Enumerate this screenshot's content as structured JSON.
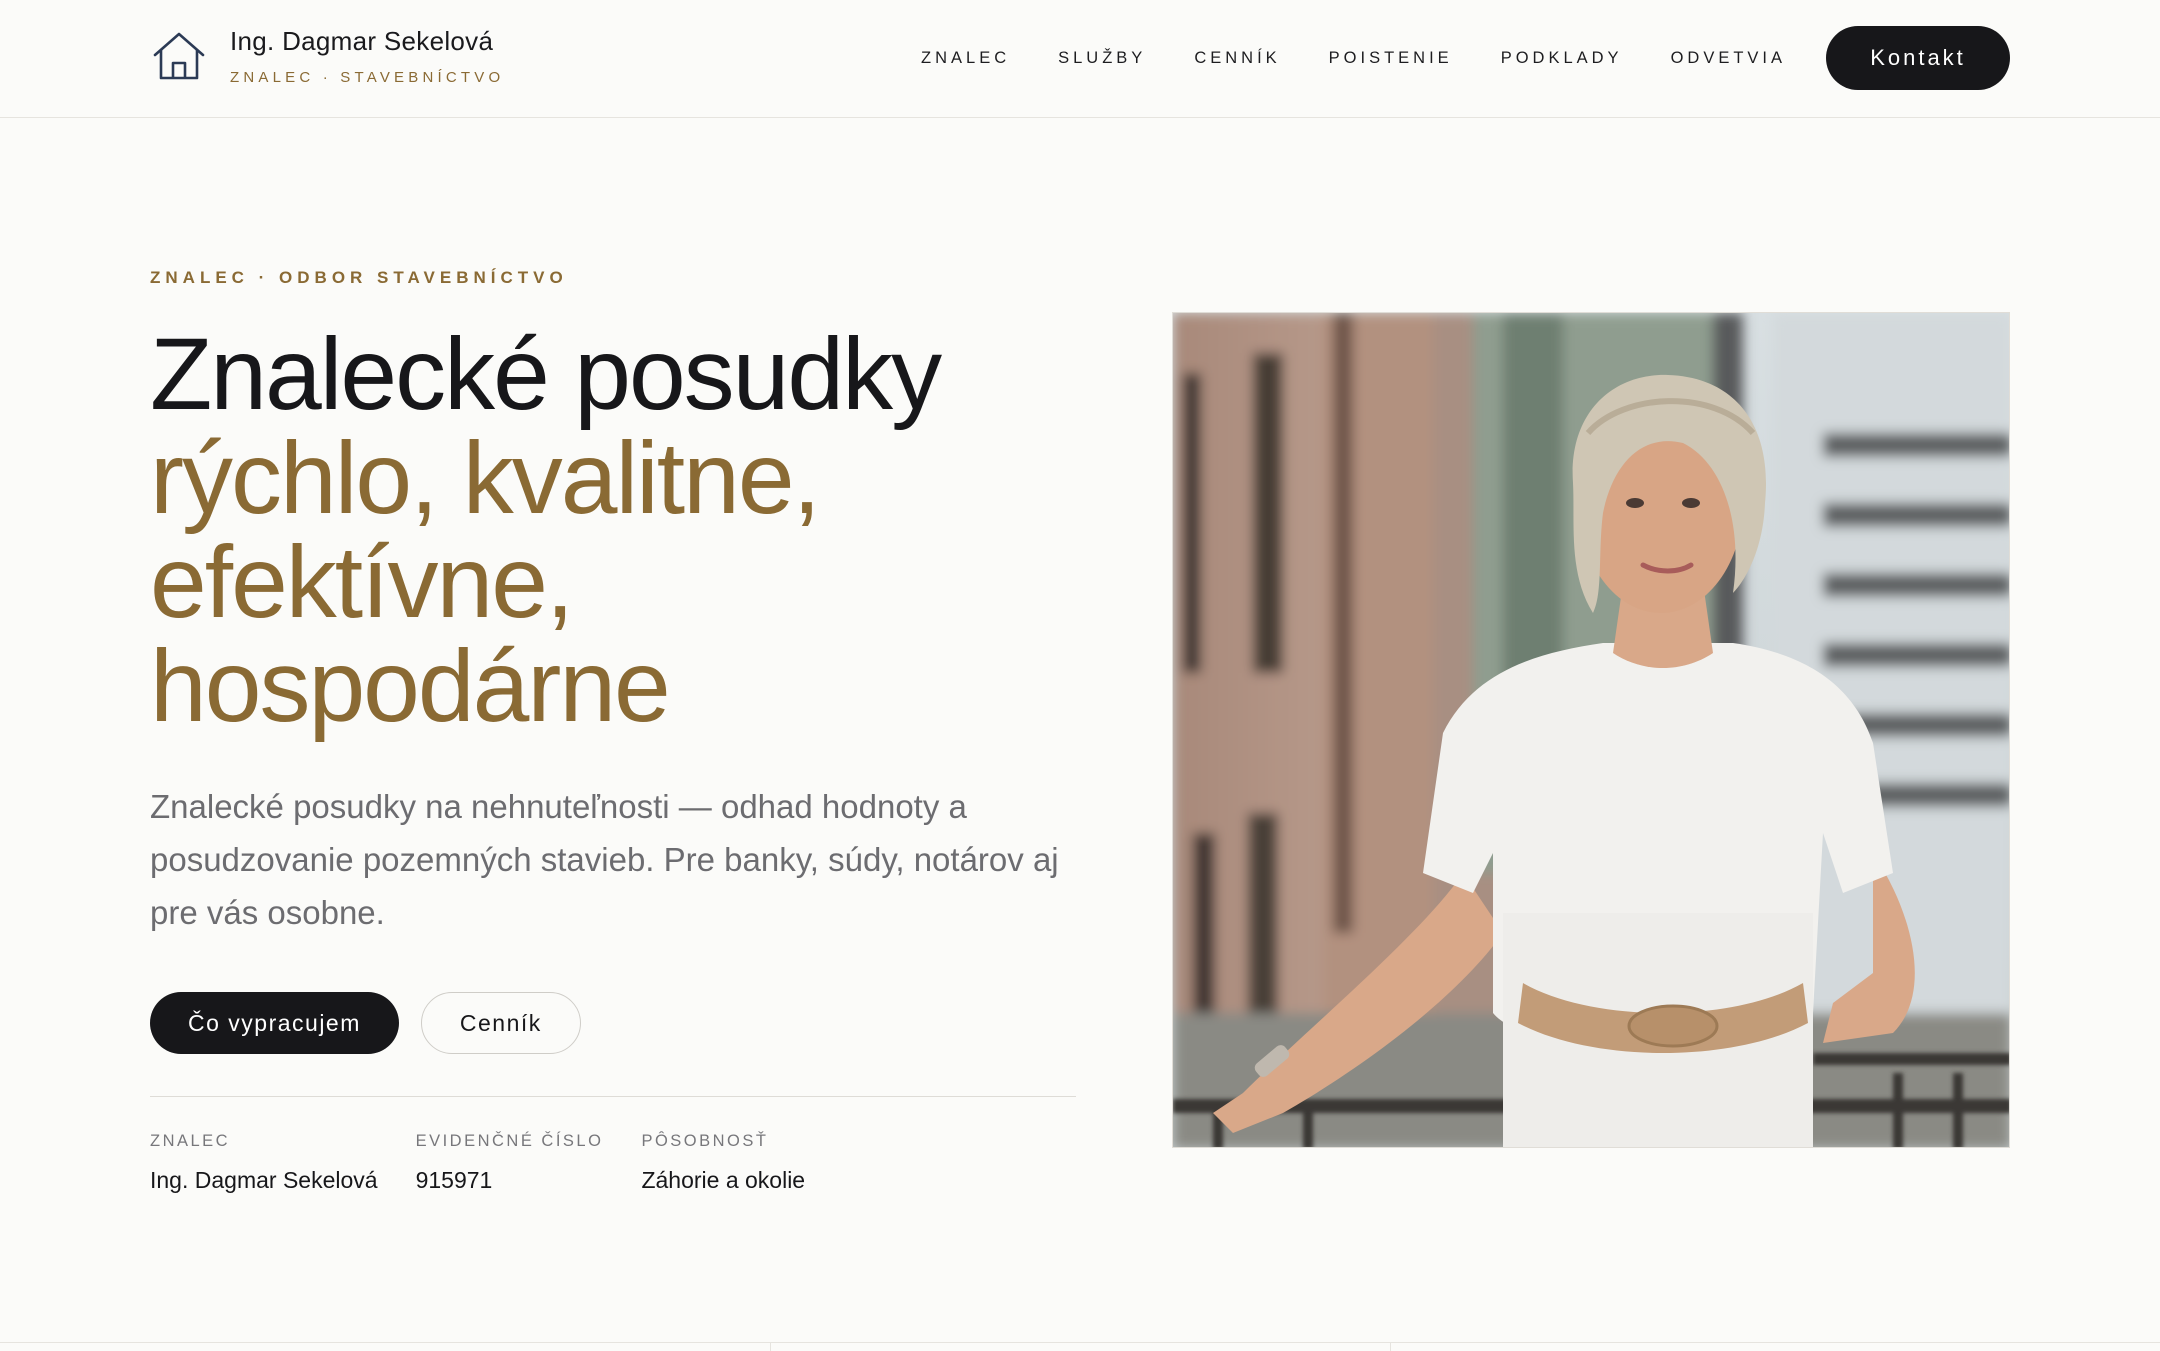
{
  "brand": {
    "name": "Ing. Dagmar Sekelová",
    "tagline": "ZNALEC · STAVEBNÍCTVO",
    "icon": "house-icon"
  },
  "nav": {
    "items": [
      "ZNALEC",
      "SLUŽBY",
      "CENNÍK",
      "POISTENIE",
      "PODKLADY",
      "ODVETVIA"
    ],
    "cta": "Kontakt"
  },
  "hero": {
    "eyebrow": "ZNALEC · ODBOR STAVEBNÍCTVO",
    "headline_line1": "Znalecké posudky",
    "headline_accent": [
      "rýchlo, kvalitne,",
      "efektívne,",
      "hospodárne"
    ],
    "lead": "Znalecké posudky na nehnuteľnosti — odhad hodnoty a posudzovanie pozemných stavieb. Pre banky, súdy, notárov aj pre vás osobne.",
    "primary_button": "Čo vypracujem",
    "secondary_button": "Cenník",
    "facts": [
      {
        "label": "ZNALEC",
        "value": "Ing. Dagmar Sekelová"
      },
      {
        "label": "EVIDENČNÉ ČÍSLO",
        "value": "915971"
      },
      {
        "label": "PÔSOBNOSŤ",
        "value": "Záhorie a okolie"
      }
    ]
  },
  "colors": {
    "accent": "#8a6a34",
    "dark": "#17171a",
    "background": "#fbfbf9",
    "muted_text": "#6c6c70"
  }
}
